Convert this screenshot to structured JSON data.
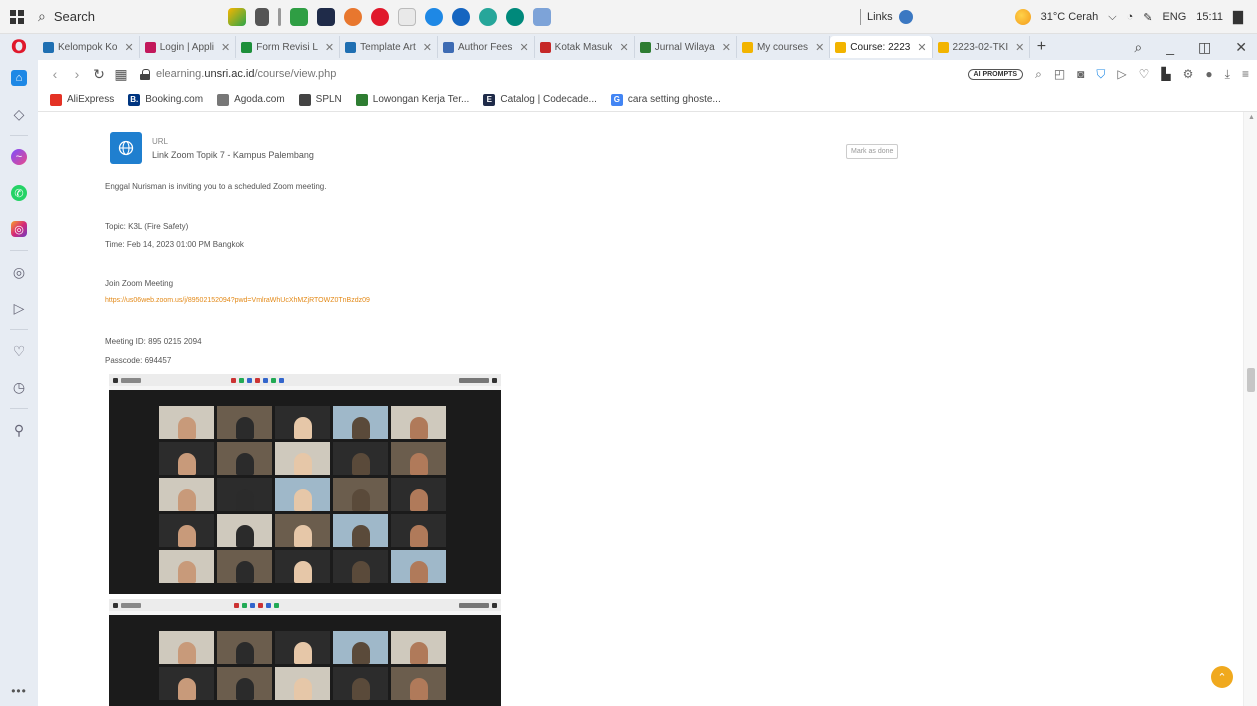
{
  "taskbar": {
    "search_label": "Search",
    "links_label": "Links",
    "weather": "31°C Cerah",
    "language": "ENG",
    "time": "15:11"
  },
  "tabs": [
    {
      "label": "Kelompok Ko",
      "color": "#1f6fb2"
    },
    {
      "label": "Login | Appli",
      "color": "#c2185b"
    },
    {
      "label": "Form Revisi L",
      "color": "#1d8f3a"
    },
    {
      "label": "Template Art",
      "color": "#1f6fb2"
    },
    {
      "label": "Author Fees",
      "color": "#3d6bb3"
    },
    {
      "label": "Kotak Masuk",
      "color": "#c62828"
    },
    {
      "label": "Jurnal Wilaya",
      "color": "#2e7d32"
    },
    {
      "label": "My courses",
      "color": "#f2b400"
    },
    {
      "label": "Course: 2223",
      "color": "#f2b400",
      "active": true
    },
    {
      "label": "2223-02-TKI",
      "color": "#f2b400"
    }
  ],
  "addressbar": {
    "url_prefix": "elearning.",
    "url_domain": "unsri.ac.id",
    "url_path": "/course/view.php",
    "ai_badge": "AI PROMPTS"
  },
  "bookmarks": [
    {
      "label": "AliExpress",
      "color": "#e43225",
      "glyph": ""
    },
    {
      "label": "Booking.com",
      "color": "#003580",
      "glyph": "B."
    },
    {
      "label": "Agoda.com",
      "color": "#777777",
      "glyph": ""
    },
    {
      "label": "SPLN",
      "color": "#444444",
      "glyph": ""
    },
    {
      "label": "Lowongan Kerja Ter...",
      "color": "#2e7d32",
      "glyph": ""
    },
    {
      "label": "Catalog | Codecade...",
      "color": "#1f2b49",
      "glyph": "E"
    },
    {
      "label": "cara setting ghoste...",
      "color": "#4285f4",
      "glyph": "G"
    }
  ],
  "activity": {
    "type_label": "URL",
    "name": "Link Zoom Topik 7 - Kampus Palembang",
    "mark_done": "Mark as done"
  },
  "invite": {
    "intro": "Enggal Nurisman is inviting you to a scheduled Zoom meeting.",
    "topic": "Topic: K3L (Fire Safety)",
    "time": "Time: Feb 14, 2023 01:00 PM Bangkok",
    "join_label": "Join Zoom Meeting",
    "join_link": "https://us06web.zoom.us/j/89502152094?pwd=VmlraWhUcXhMZjRTOWZ0TnBzdz09",
    "meeting_id": "Meeting ID: 895 0215 2094",
    "passcode": "Passcode: 694457"
  }
}
